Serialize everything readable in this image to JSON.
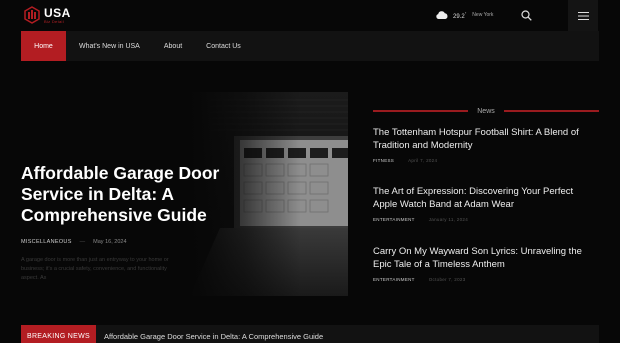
{
  "header": {
    "logo_title": "USA",
    "logo_sub": "Biz Detail",
    "weather_icon": "cloud-icon",
    "temp": "29.2",
    "temp_unit": "°",
    "city": "New York"
  },
  "nav": {
    "items": [
      {
        "label": "Home",
        "active": true
      },
      {
        "label": "What's New in USA",
        "active": false
      },
      {
        "label": "About",
        "active": false
      },
      {
        "label": "Contact Us",
        "active": false
      }
    ]
  },
  "hero": {
    "title": "Affordable Garage Door Service in Delta: A Comprehensive Guide",
    "category": "MISCELLANEOUS",
    "date": "May 16, 2024",
    "excerpt": "A garage door is more than just an entryway to your home or business; it's a crucial safety, convenience, and functionality aspect. As"
  },
  "news": {
    "label": "News",
    "items": [
      {
        "title": "The Tottenham Hotspur Football Shirt: A Blend of Tradition and Modernity",
        "category": "FITNESS",
        "date": "April 7, 2024"
      },
      {
        "title": "The Art of Expression: Discovering Your Perfect Apple Watch Band at Adam Wear",
        "category": "ENTERTAINMENT",
        "date": "January 11, 2024"
      },
      {
        "title": "Carry On My Wayward Son Lyrics: Unraveling the Epic Tale of a Timeless Anthem",
        "category": "ENTERTAINMENT",
        "date": "October 7, 2023"
      }
    ]
  },
  "breaking": {
    "label": "BREAKING NEWS",
    "headline": "Affordable Garage Door Service in Delta: A Comprehensive Guide"
  },
  "colors": {
    "accent": "#b31d22",
    "background": "#070707",
    "panel": "#121212"
  }
}
